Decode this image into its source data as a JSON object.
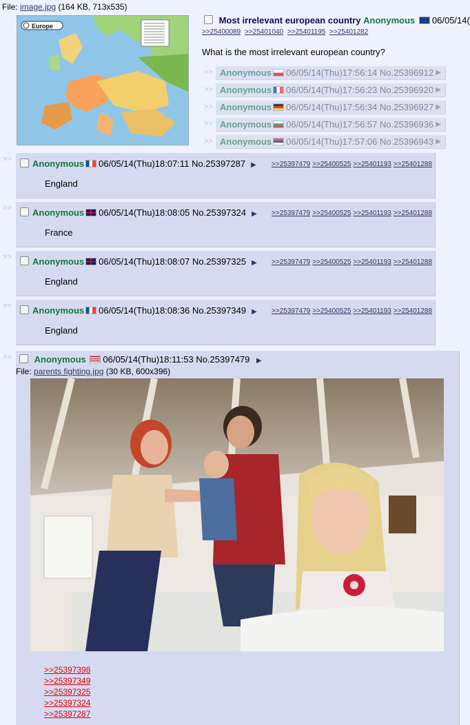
{
  "op": {
    "file_label": "File:",
    "file_name": "image.jpg",
    "file_meta": "(164 KB, 713x535)",
    "map_title": "Europe",
    "subject": "Most irrelevant european country",
    "name": "Anonymous",
    "datetime": "06/05/14(",
    "backlinks": [
      ">>25400089",
      ">>25401040",
      ">>25401195",
      ">>25401282"
    ],
    "message": "What is the most irrelevant european country?"
  },
  "stubs": [
    {
      "name": "Anonymous",
      "datetime": "06/05/14(Thu)17:56:14",
      "postno": "No.25396912",
      "flag": "poland"
    },
    {
      "name": "Anonymous",
      "datetime": "06/05/14(Thu)17:56:23",
      "postno": "No.25396920",
      "flag": "france"
    },
    {
      "name": "Anonymous",
      "datetime": "06/05/14(Thu)17:56:34",
      "postno": "No.25396927",
      "flag": "germany"
    },
    {
      "name": "Anonymous",
      "datetime": "06/05/14(Thu)17:56:57",
      "postno": "No.25396936",
      "flag": "bulgaria"
    },
    {
      "name": "Anonymous",
      "datetime": "06/05/14(Thu)17:57:06",
      "postno": "No.25396943",
      "flag": "serbia"
    }
  ],
  "replies": [
    {
      "name": "Anonymous",
      "datetime": "06/05/14(Thu)18:07:11",
      "postno": "No.25397287",
      "flag": "france",
      "message": "England",
      "backlinks": [
        ">>25397479",
        ">>25400525",
        ">>25401193",
        ">>25401288"
      ]
    },
    {
      "name": "Anonymous",
      "datetime": "06/05/14(Thu)18:08:05",
      "postno": "No.25397324",
      "flag": "uk",
      "message": "France",
      "backlinks": [
        ">>25397479",
        ">>25400525",
        ">>25401193",
        ">>25401288"
      ]
    },
    {
      "name": "Anonymous",
      "datetime": "06/05/14(Thu)18:08:07",
      "postno": "No.25397325",
      "flag": "uk",
      "message": "England",
      "backlinks": [
        ">>25397479",
        ">>25400525",
        ">>25401193",
        ">>25401288"
      ]
    },
    {
      "name": "Anonymous",
      "datetime": "06/05/14(Thu)18:08:36",
      "postno": "No.25397349",
      "flag": "france",
      "message": "England",
      "backlinks": [
        ">>25397479",
        ">>25400525",
        ">>25401193",
        ">>25401288"
      ]
    }
  ],
  "big_post": {
    "name": "Anonymous",
    "datetime": "06/05/14(Thu)18:11:53",
    "postno": "No.25397479",
    "flag": "usa",
    "file_label": "File:",
    "file_name": "parents fighting.jpg",
    "file_meta": "(30 KB, 600x396)",
    "quotes": [
      ">>25397398",
      ">>25397349",
      ">>25397325",
      ">>25397324",
      ">>25397287"
    ]
  },
  "ui": {
    "arrows": ">>",
    "triangle": "▶"
  },
  "colors": {
    "name": "#117743",
    "subject": "#0f0c5d",
    "quote": "#dd0000",
    "post_bg": "#d6daf0"
  }
}
